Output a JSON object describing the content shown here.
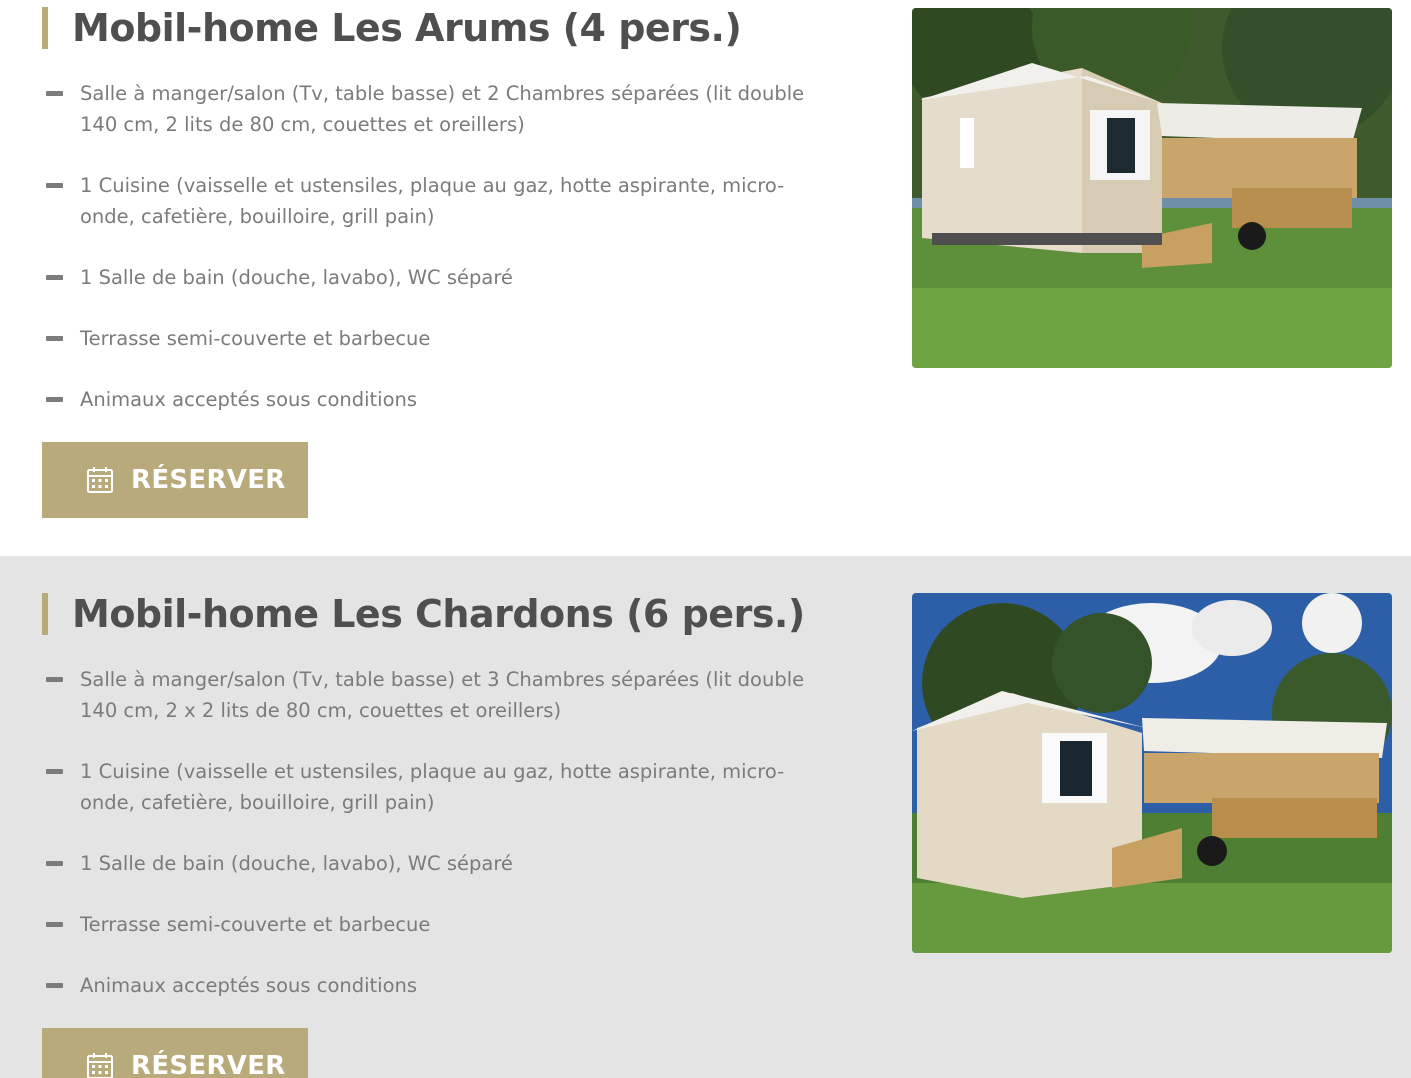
{
  "listings": [
    {
      "title": "Mobil-home Les Arums (4 pers.)",
      "features": [
        "Salle à manger/salon (Tv, table basse) et 2 Chambres séparées (lit double 140 cm, 2 lits de 80 cm, couettes et oreillers)",
        "1 Cuisine (vaisselle et ustensiles, plaque au gaz, hotte aspirante, micro-onde, cafetière, bouilloire, grill pain)",
        "1 Salle de bain (douche, lavabo), WC séparé",
        "Terrasse semi-couverte et barbecue",
        "Animaux acceptés sous conditions"
      ],
      "button_label": "RÉSERVER",
      "button_icon": "calendar-icon"
    },
    {
      "title": "Mobil-home Les Chardons (6 pers.)",
      "features": [
        "Salle à manger/salon (Tv, table basse) et 3 Chambres séparées (lit double 140 cm, 2 x 2 lits de 80 cm, couettes et oreillers)",
        "1 Cuisine (vaisselle et ustensiles, plaque au gaz, hotte aspirante, micro-onde, cafetière, bouilloire, grill pain)",
        "1 Salle de bain (douche, lavabo), WC séparé",
        "Terrasse semi-couverte et barbecue",
        "Animaux acceptés sous conditions"
      ],
      "button_label": "RÉSERVER",
      "button_icon": "calendar-icon"
    }
  ],
  "colors": {
    "accent": "#b9aa7c",
    "title": "#4f4f4f",
    "text": "#7b7b7b",
    "section_alt_bg": "#e4e4e4"
  }
}
